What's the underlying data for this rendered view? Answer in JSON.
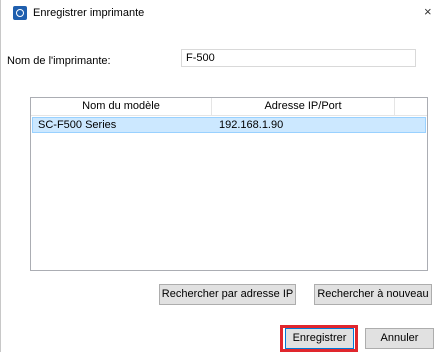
{
  "window": {
    "title": "Enregistrer imprimante",
    "close_symbol": "×",
    "icon": "printer-app-icon"
  },
  "form": {
    "name_label": "Nom de l'imprimante:",
    "name_value": "F-500"
  },
  "table": {
    "columns": [
      "Nom du modèle",
      "Adresse IP/Port",
      ""
    ],
    "rows": [
      {
        "model": "SC-F500 Series",
        "ip": "192.168.1.90",
        "selected": true
      }
    ]
  },
  "buttons": {
    "search_by_ip": "Rechercher par adresse IP",
    "search_again": "Rechercher à nouveau",
    "register": "Enregistrer",
    "cancel": "Annuler"
  },
  "colors": {
    "selection": "#cce8ff",
    "highlight": "#e0262d",
    "icon": "#1f5fae"
  }
}
